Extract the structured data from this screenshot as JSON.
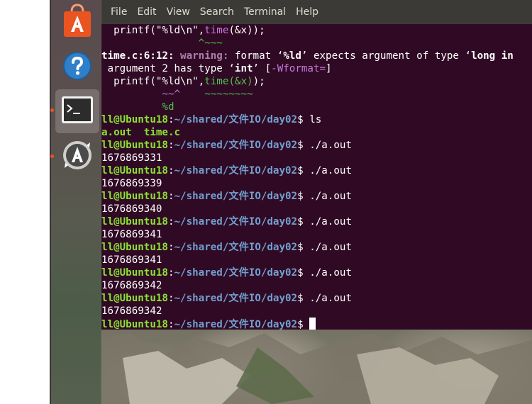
{
  "launcher": {
    "items": [
      {
        "name": "ubuntu-software-icon"
      },
      {
        "name": "help-icon"
      },
      {
        "name": "terminal-icon"
      },
      {
        "name": "software-updater-icon"
      }
    ]
  },
  "terminal": {
    "menu": [
      "File",
      "Edit",
      "View",
      "Search",
      "Terminal",
      "Help"
    ],
    "lines": [
      {
        "parts": [
          {
            "t": "  printf(\"%ld\\n\",",
            "c": "plain"
          },
          {
            "t": "time",
            "c": "m"
          },
          {
            "t": "(&x));",
            "c": "plain"
          }
        ]
      },
      {
        "parts": [
          {
            "t": "                ^~~~",
            "c": "gr"
          }
        ]
      },
      {
        "parts": [
          {
            "t": "time.c:6:12: ",
            "c": "bw"
          },
          {
            "t": "warning: ",
            "c": "mw"
          },
          {
            "t": "format ‘",
            "c": "plain"
          },
          {
            "t": "%ld",
            "c": "bw"
          },
          {
            "t": "’ expects argument of type ‘",
            "c": "plain"
          },
          {
            "t": "long in",
            "c": "bw"
          }
        ]
      },
      {
        "parts": [
          {
            "t": " argument 2 has type ‘",
            "c": "plain"
          },
          {
            "t": "int",
            "c": "bw"
          },
          {
            "t": "’ [",
            "c": "plain"
          },
          {
            "t": "-Wformat=",
            "c": "m"
          },
          {
            "t": "]",
            "c": "plain"
          }
        ]
      },
      {
        "parts": [
          {
            "t": "  printf(\"%ld\\n\",",
            "c": "plain"
          },
          {
            "t": "time(&x)",
            "c": "gr"
          },
          {
            "t": ");",
            "c": "plain"
          }
        ]
      },
      {
        "parts": [
          {
            "t": "          ~~^    ",
            "c": "m"
          },
          {
            "t": "~~~~~~~~",
            "c": "gr"
          }
        ]
      },
      {
        "parts": [
          {
            "t": "          %d",
            "c": "gr"
          }
        ]
      },
      {
        "parts": [
          {
            "t": "ll@Ubuntu18",
            "c": "g"
          },
          {
            "t": ":",
            "c": "plain"
          },
          {
            "t": "~/shared/文件IO/day02",
            "c": "b"
          },
          {
            "t": "$ ls",
            "c": "plain"
          }
        ]
      },
      {
        "parts": [
          {
            "t": "a.out  time.c",
            "c": "g"
          }
        ]
      },
      {
        "parts": [
          {
            "t": "ll@Ubuntu18",
            "c": "g"
          },
          {
            "t": ":",
            "c": "plain"
          },
          {
            "t": "~/shared/文件IO/day02",
            "c": "b"
          },
          {
            "t": "$ ./a.out",
            "c": "plain"
          }
        ]
      },
      {
        "parts": [
          {
            "t": "1676869331",
            "c": "plain"
          }
        ]
      },
      {
        "parts": [
          {
            "t": "ll@Ubuntu18",
            "c": "g"
          },
          {
            "t": ":",
            "c": "plain"
          },
          {
            "t": "~/shared/文件IO/day02",
            "c": "b"
          },
          {
            "t": "$ ./a.out",
            "c": "plain"
          }
        ]
      },
      {
        "parts": [
          {
            "t": "1676869339",
            "c": "plain"
          }
        ]
      },
      {
        "parts": [
          {
            "t": "ll@Ubuntu18",
            "c": "g"
          },
          {
            "t": ":",
            "c": "plain"
          },
          {
            "t": "~/shared/文件IO/day02",
            "c": "b"
          },
          {
            "t": "$ ./a.out",
            "c": "plain"
          }
        ]
      },
      {
        "parts": [
          {
            "t": "1676869340",
            "c": "plain"
          }
        ]
      },
      {
        "parts": [
          {
            "t": "ll@Ubuntu18",
            "c": "g"
          },
          {
            "t": ":",
            "c": "plain"
          },
          {
            "t": "~/shared/文件IO/day02",
            "c": "b"
          },
          {
            "t": "$ ./a.out",
            "c": "plain"
          }
        ]
      },
      {
        "parts": [
          {
            "t": "1676869341",
            "c": "plain"
          }
        ]
      },
      {
        "parts": [
          {
            "t": "ll@Ubuntu18",
            "c": "g"
          },
          {
            "t": ":",
            "c": "plain"
          },
          {
            "t": "~/shared/文件IO/day02",
            "c": "b"
          },
          {
            "t": "$ ./a.out",
            "c": "plain"
          }
        ]
      },
      {
        "parts": [
          {
            "t": "1676869341",
            "c": "plain"
          }
        ]
      },
      {
        "parts": [
          {
            "t": "ll@Ubuntu18",
            "c": "g"
          },
          {
            "t": ":",
            "c": "plain"
          },
          {
            "t": "~/shared/文件IO/day02",
            "c": "b"
          },
          {
            "t": "$ ./a.out",
            "c": "plain"
          }
        ]
      },
      {
        "parts": [
          {
            "t": "1676869342",
            "c": "plain"
          }
        ]
      },
      {
        "parts": [
          {
            "t": "ll@Ubuntu18",
            "c": "g"
          },
          {
            "t": ":",
            "c": "plain"
          },
          {
            "t": "~/shared/文件IO/day02",
            "c": "b"
          },
          {
            "t": "$ ./a.out",
            "c": "plain"
          }
        ]
      },
      {
        "parts": [
          {
            "t": "1676869342",
            "c": "plain"
          }
        ]
      },
      {
        "parts": [
          {
            "t": "ll@Ubuntu18",
            "c": "g"
          },
          {
            "t": ":",
            "c": "plain"
          },
          {
            "t": "~/shared/文件IO/day02",
            "c": "b"
          },
          {
            "t": "$ ",
            "c": "plain"
          }
        ],
        "cursor": true
      }
    ]
  },
  "colors": {
    "terminal_bg": "#300a24",
    "menubar_bg": "#3b3a36",
    "prompt_user": "#8ae234",
    "prompt_path": "#729fcf",
    "accent": "#e95420"
  }
}
